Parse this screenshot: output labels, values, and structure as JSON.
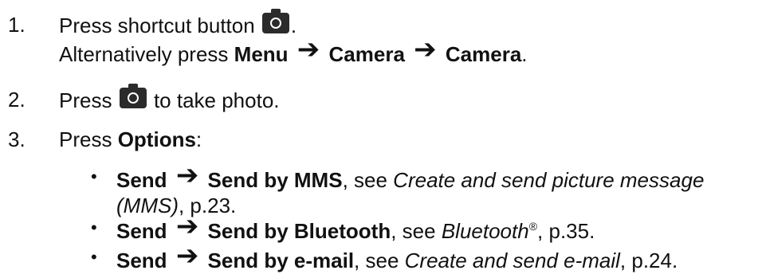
{
  "steps": [
    {
      "num": "1.",
      "l1_pre": "Press shortcut button",
      "l1_post": ".",
      "l2_pre": "Alternatively press",
      "menu": "Menu",
      "camera1": "Camera",
      "camera2": "Camera",
      "l2_post": "."
    },
    {
      "num": "2.",
      "pre": "Press",
      "post": "to take photo."
    },
    {
      "num": "3.",
      "pre": "Press",
      "options": "Options",
      "post": ":"
    }
  ],
  "bullets": [
    {
      "send": "Send",
      "target": "Send by MMS",
      "see": ", see",
      "ref": "Create and send picture message",
      "ref2": "(MMS)",
      "page": ", p.23."
    },
    {
      "send": "Send",
      "target": "Send by Bluetooth",
      "see": ", see",
      "ref": "Bluetooth",
      "sup": "®",
      "page": ", p.35."
    },
    {
      "send": "Send",
      "target": "Send by e-mail",
      "see": ", see",
      "ref": "Create and send e-mail",
      "page": ", p.24."
    }
  ],
  "glyphs": {
    "bullet": "•",
    "arrow": "➔"
  },
  "icons": {
    "camera": "camera-icon",
    "arrow": "arrow-right-icon"
  }
}
